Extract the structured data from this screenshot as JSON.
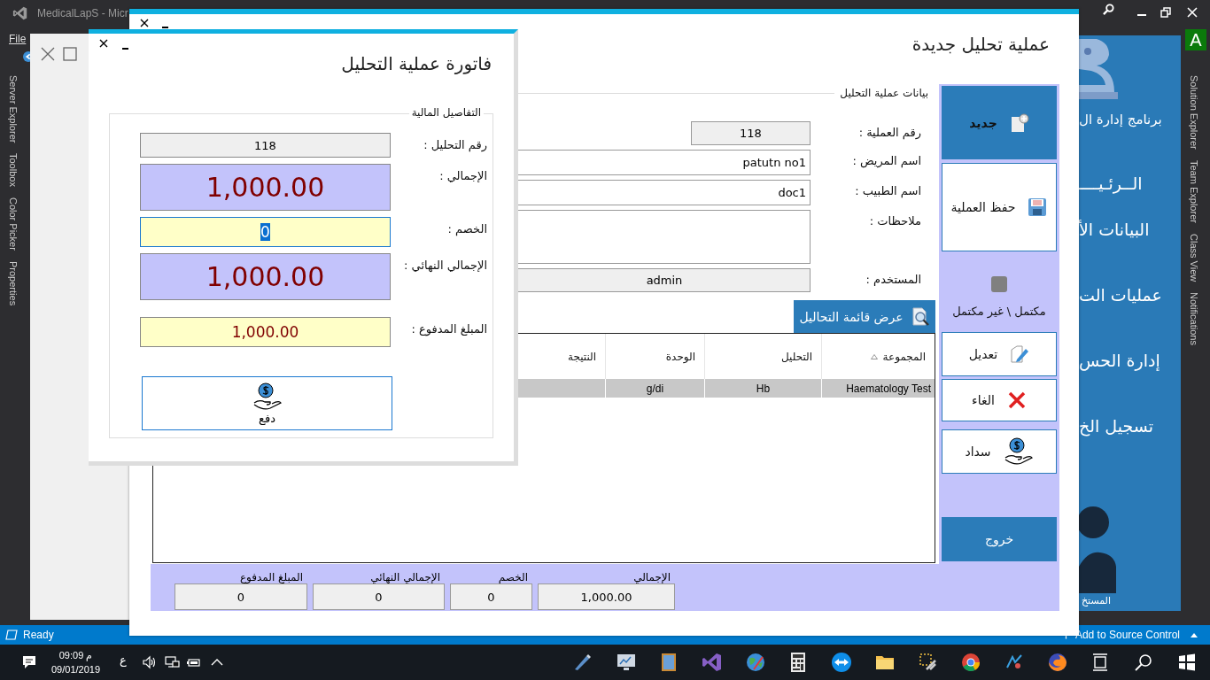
{
  "ide": {
    "title": "MedicalLapS - Micr",
    "menu": [
      "File"
    ],
    "left_tabs": [
      "Server Explorer",
      "Toolbox",
      "Color Picker",
      "Properties"
    ],
    "right_tabs": [
      "Solution Explorer",
      "Team Explorer",
      "Class View",
      "Notifications"
    ],
    "account_badge": "A",
    "status": "Ready",
    "source_control": "Add to Source Control"
  },
  "app_sidebar": {
    "items": [
      {
        "label": "برنامج إدارة ال",
        "kind": "heading"
      },
      {
        "label": "الــرئـيــــ",
        "kind": "menu"
      },
      {
        "label": "البيانات الأ",
        "kind": "menu"
      },
      {
        "label": "عمليات الت",
        "kind": "menu"
      },
      {
        "label": "إدارة الحس",
        "kind": "menu"
      },
      {
        "label": "تسجيل الخ",
        "kind": "menu"
      }
    ],
    "user_label": "المستخ"
  },
  "analysis_form": {
    "title": "عملية تحليل جديدة",
    "group_title": "بيانات عملية التحليل",
    "fields": [
      {
        "label": "رقم العملية :",
        "value": "118",
        "kind": "number"
      },
      {
        "label": "اسم المريض :",
        "value": "patutn no1",
        "kind": "combo"
      },
      {
        "label": "اسم الطبيب :",
        "value": "doc1",
        "kind": "combo"
      },
      {
        "label": "ملاحظات :",
        "kind": "memo"
      },
      {
        "label": "المستخدم :",
        "value": "admin",
        "kind": "readonly"
      }
    ],
    "list_button": "عرض قائمة التحاليل",
    "table": {
      "columns": [
        {
          "label": "المجموعة",
          "sorted": true
        },
        {
          "label": "التحليل",
          "sorted": false
        },
        {
          "label": "الوحدة",
          "sorted": false
        },
        {
          "label": "النتيجة",
          "sorted": false
        }
      ],
      "rows": [
        {
          "cells": [
            "Haematology Test",
            "Hb",
            "g/di"
          ],
          "selected": true
        }
      ]
    },
    "actions": [
      {
        "label": "جديد",
        "kind": "new",
        "primary": true
      },
      {
        "label": "حفظ العملية",
        "kind": "save",
        "primary": false
      },
      {
        "label": "مكتمل \\ غير مكتمل",
        "kind": "status",
        "complete": false
      },
      {
        "label": "تعديل",
        "kind": "edit",
        "primary": false
      },
      {
        "label": "الغاء",
        "kind": "cancel",
        "primary": false
      },
      {
        "label": "سداد",
        "kind": "pay",
        "primary": false
      },
      {
        "label": "خروج",
        "kind": "exit",
        "primary": true
      }
    ],
    "totals": [
      {
        "label": "الإجمالي",
        "value": "1,000.00"
      },
      {
        "label": "الخصم",
        "value": "0"
      },
      {
        "label": "الإجمالي النهائي",
        "value": "0"
      },
      {
        "label": "المبلغ المدفوع",
        "value": "0"
      }
    ]
  },
  "invoice_dialog": {
    "title": "فاتورة عملية التحليل",
    "group_title": "التفاصيل المالية",
    "fields": [
      {
        "label": "رقم التحليل :",
        "value": "118",
        "kind": "readonly",
        "focused": false
      },
      {
        "label": "الإجمالي :",
        "value": "1,000.00",
        "kind": "large",
        "focused": false
      },
      {
        "label": "الخصم :",
        "value": "0",
        "kind": "input",
        "focused": true
      },
      {
        "label": "الإجمالي النهائي :",
        "value": "1,000.00",
        "kind": "large",
        "focused": false
      },
      {
        "label": "المبلغ المدفوع :",
        "value": "1,000.00",
        "kind": "input",
        "focused": false
      }
    ],
    "pay_button": "دفع"
  },
  "taskbar": {
    "time": "09:09",
    "period": "م",
    "date": "09/01/2019",
    "language": "ع"
  }
}
